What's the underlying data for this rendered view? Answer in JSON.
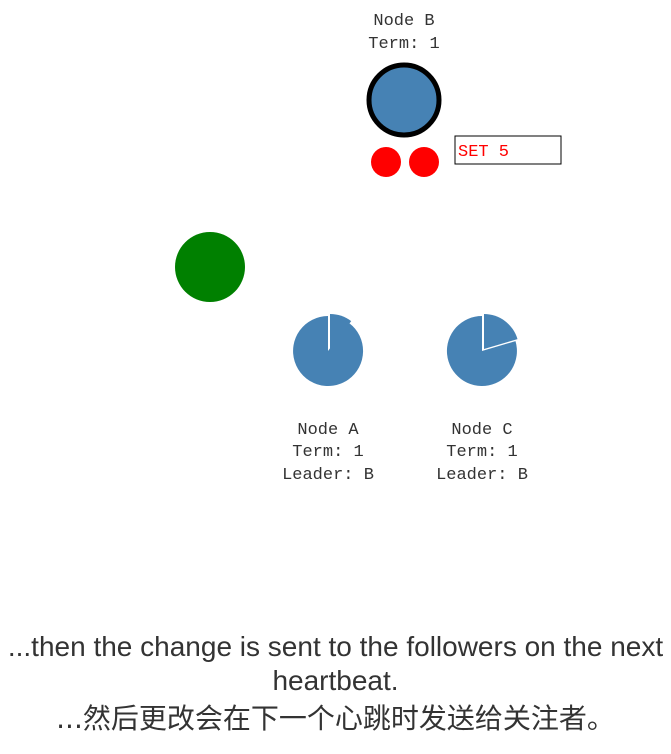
{
  "colors": {
    "node": "#4682B4",
    "node_selected_stroke": "#000000",
    "client": "#008000",
    "message": "#ff0000",
    "log_text": "#ff0000"
  },
  "nodes": {
    "b": {
      "name": "Node B",
      "term": "Term: 1"
    },
    "a": {
      "name": "Node A",
      "term": "Term: 1",
      "leader": "Leader: B"
    },
    "c": {
      "name": "Node C",
      "term": "Term: 1",
      "leader": "Leader: B"
    }
  },
  "log_entry": {
    "text": "SET 5"
  },
  "caption": {
    "en": "...then the change is sent to the followers on the next heartbeat.",
    "zh": "...然后更改会在下一个心跳时发送给关注者。"
  }
}
